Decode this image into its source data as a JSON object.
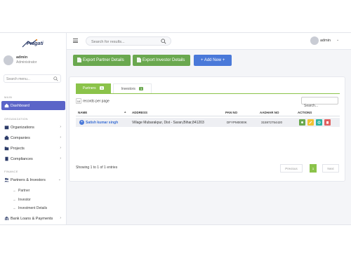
{
  "app": {
    "logo_text": "Pragati"
  },
  "user": {
    "name": "admin",
    "role": "Administrator"
  },
  "sidebar": {
    "search_placeholder": "Search menu...",
    "main_section": "MAIN",
    "dashboard": "Dashboard",
    "organization_section": "ORGANIZATION",
    "org_items": [
      "Organizations",
      "Companies",
      "Projects",
      "Compliances"
    ],
    "finance_section": "FINANCE",
    "partners_investors": "Partners & Investors",
    "sub_items": [
      "Partner",
      "Investor",
      "Investment Details"
    ],
    "bank_loans": "Bank Loans & Payments"
  },
  "topbar": {
    "search_placeholder": "Search for results...",
    "user_name": "admin"
  },
  "actions": {
    "export_partner": "Export Partner Details",
    "export_investor": "Export Investor Details",
    "add_new": "+ Add New +"
  },
  "tabs": [
    {
      "label": "Partners",
      "count": "1"
    },
    {
      "label": "Investors",
      "count": "1"
    }
  ],
  "table": {
    "records_per_page": "records per page",
    "page_size": "10",
    "search_placeholder": "Search...",
    "columns": [
      "NAME",
      "ADDRESS",
      "PAN NO",
      "AADHAR NO",
      "ACTIONS"
    ],
    "rows": [
      {
        "name": "Satish kumar singh",
        "address": "Village Mubarakpur, Dist - Saran,Bihar,841203",
        "pan": "DFYPM0000K",
        "aadhar": "315972754420"
      }
    ],
    "info": "Showing 1 to 1 of 1 entries",
    "prev": "Previous",
    "page": "1",
    "next": "Next"
  },
  "colors": {
    "accent": "#5b64c8",
    "green": "#6aa84f",
    "tab_green": "#8bc34a",
    "blue": "#4a79d9",
    "action_view": "#6aa84f",
    "action_edit": "#f1c232",
    "action_link": "#2bb3a3",
    "action_delete": "#e06060"
  }
}
